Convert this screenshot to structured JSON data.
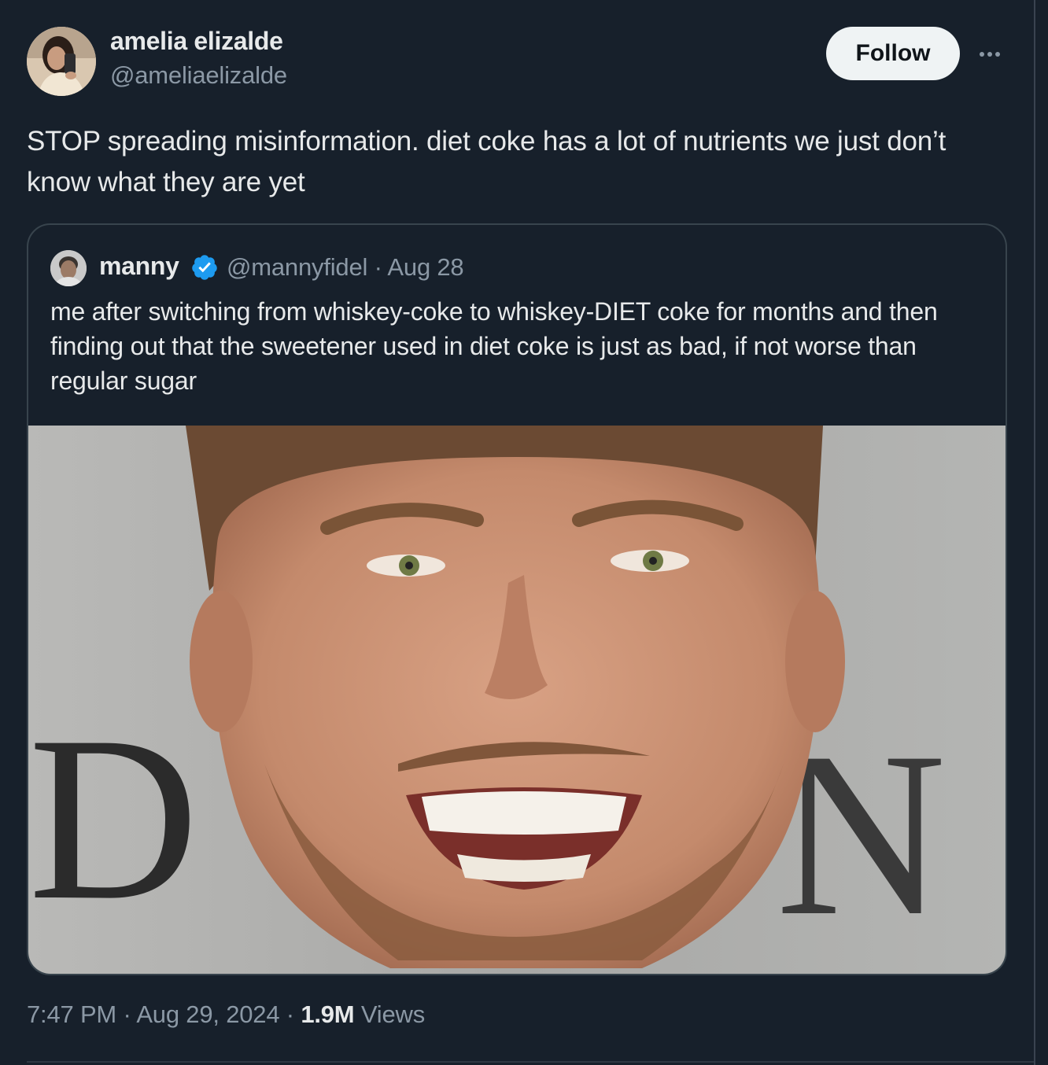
{
  "author": {
    "display_name": "amelia elizalde",
    "handle": "@ameliaelizalde"
  },
  "actions": {
    "follow_label": "Follow"
  },
  "tweet": {
    "text": "STOP spreading misinformation. diet coke has a lot of nutrients we just don’t know what they are yet"
  },
  "quoted_tweet": {
    "display_name": "manny",
    "handle_date": "@mannyfidel · Aug 28",
    "text": "me after switching from whiskey-coke to whiskey-DIET coke for months and then finding out that the sweetener used in diet coke is just as bad, if not worse than regular sugar",
    "image_letters": [
      "D",
      "N"
    ]
  },
  "meta": {
    "time": "7:47 PM",
    "date": "Aug 29, 2024",
    "views_count": "1.9M",
    "views_label": "Views"
  },
  "icons": [
    "more-icon",
    "verified-badge-icon"
  ],
  "colors": {
    "background": "#17202b",
    "text_primary": "#e7e9ea",
    "text_secondary": "#8b98a5",
    "verified": "#1d9bf0",
    "follow_bg": "#eff3f4"
  }
}
